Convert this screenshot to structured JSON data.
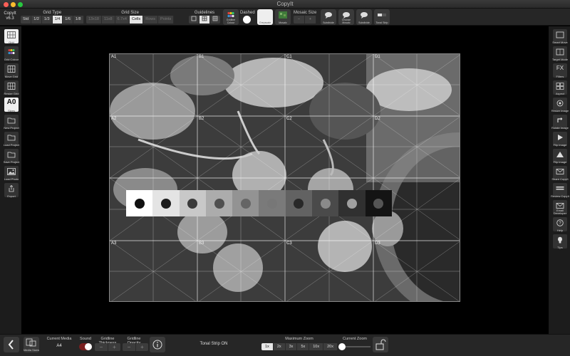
{
  "window": {
    "title": "CopyIt"
  },
  "app": {
    "name": "CopyIt",
    "version": "v6.3"
  },
  "toolbar": {
    "grid_type": {
      "label": "Grid Type",
      "options": [
        "Std",
        "1/2",
        "1/3",
        "1/4",
        "1/6",
        "1/8"
      ],
      "selected": "1/4"
    },
    "grid_size": {
      "label": "Grid Size",
      "options": [
        "13x18",
        "11x8",
        "6.7x4",
        "Cells",
        "Rows",
        "Points"
      ],
      "selected": "Cells"
    },
    "guidelines": {
      "label": "Guidelines"
    },
    "colours_label": "Gridline Colour",
    "dashed_label": "Dashed",
    "greyscale_label": "Greyscale",
    "mosaic_label": "Mosaic",
    "mosaic_size_label": "Mosaic Size",
    "subdivide_label": "Subdivide",
    "choose_label": "Choose Mosaic",
    "subdivide2_label": "Subdivide",
    "tonal_strip_label": "Tonal Strip"
  },
  "left_sidebar": {
    "items": [
      {
        "label": "Grid"
      },
      {
        "label": "Grid Colour"
      },
      {
        "label": "Move Grid"
      },
      {
        "label": "Resize Grid"
      },
      {
        "label": "Sizes",
        "badge": "A0"
      },
      {
        "label": "New Project"
      },
      {
        "label": "Load Project"
      },
      {
        "label": "Save Project"
      },
      {
        "label": "Load Photo"
      },
      {
        "label": "Export"
      }
    ]
  },
  "right_sidebar": {
    "items": [
      {
        "label": "Smart Move"
      },
      {
        "label": "Target Mode"
      },
      {
        "label": "Filters",
        "badge": "FX"
      },
      {
        "label": "Aspect"
      },
      {
        "label": "Resize Image"
      },
      {
        "label": "Rotate Image"
      },
      {
        "label": "Flip Image"
      },
      {
        "label": "Flip Image"
      },
      {
        "label": "Share CopyIt"
      },
      {
        "label": "Review CopyIt"
      },
      {
        "label": "Email Developer"
      },
      {
        "label": "Help"
      },
      {
        "label": "Tips"
      }
    ]
  },
  "grid": {
    "cell_labels": [
      "A1",
      "B1",
      "C1",
      "D1",
      "A2",
      "B2",
      "C2",
      "D2",
      "A3",
      "B3",
      "C3",
      "D3"
    ]
  },
  "tonal_strip": {
    "swatches": [
      "#ffffff",
      "#e4e4e4",
      "#c8c8c8",
      "#acacac",
      "#939393",
      "#7a7a7a",
      "#626262",
      "#4a4a4a",
      "#303030",
      "#141414"
    ],
    "dots": [
      "#111111",
      "#1c1c1c",
      "#3a3a3a",
      "#505050",
      "#656565",
      "#777777",
      "#282828",
      "#8a8a8a",
      "#a0a0a0",
      "#555555"
    ]
  },
  "bottombar": {
    "current_media_label": "Current Media",
    "current_media_value": "A4",
    "media_sizes_label": "Media Sizes",
    "sound_label": "Sound",
    "gridline_thickness_label": "Gridline Thickness",
    "gridline_opacity_label": "Gridline Opacity",
    "status": "Tonal Strip ON",
    "max_zoom_label": "Maximum Zoom",
    "zoom_options": [
      "1x",
      "2x",
      "3x",
      "5x",
      "10x",
      "20x"
    ],
    "zoom_selected": "1x",
    "current_zoom_label": "Current Zoom",
    "current_zoom": 0
  }
}
